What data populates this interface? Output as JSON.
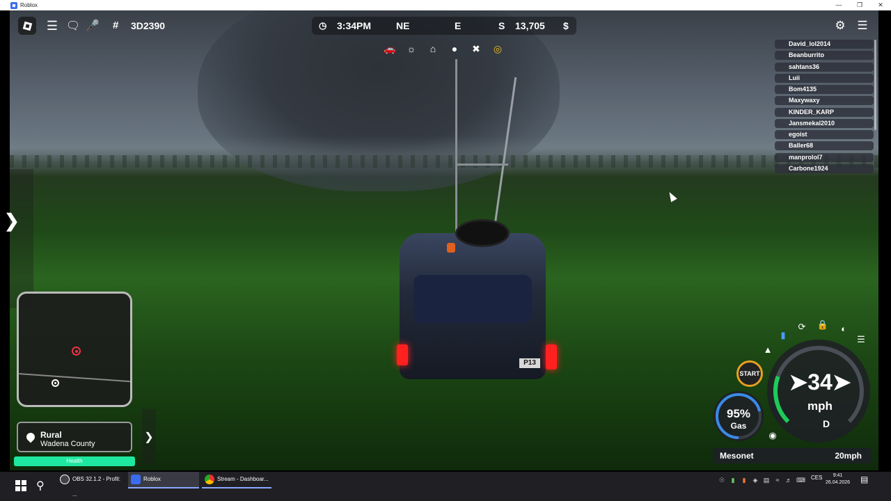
{
  "window": {
    "title": "Roblox",
    "buttons": [
      "—",
      "❐",
      "✕"
    ]
  },
  "hud": {
    "server_hash": "#",
    "server_id": "3D2390",
    "time": "3:34PM",
    "heading_primary": "NE",
    "heading_secondary": "E",
    "heading_tertiary": "S",
    "money": "13,705",
    "currency": "$",
    "toolbar_icons": [
      "car-icon",
      "sun-icon",
      "home-icon",
      "person-icon",
      "tools-icon",
      "radar-icon"
    ]
  },
  "players": [
    "David_lol2014",
    "Beanburrito",
    "sahtans36",
    "Luii",
    "Bom4135",
    "Maxywaxy",
    "KINDER_KARP",
    "Jansmekal2010",
    "egoist",
    "Baller68",
    "manprolol7",
    "Carbone1924"
  ],
  "location": {
    "area": "Rural",
    "county": "Wadena County"
  },
  "health": {
    "label": "Health",
    "value": 1.0,
    "color": "#1ee8a0"
  },
  "vehicle": {
    "speed": "34",
    "speed_unit": "mph",
    "gear": "D",
    "gas_percent": "95%",
    "gas_value": 0.95,
    "gas_label": "Gas",
    "start_label": "START",
    "plate": "P13",
    "accent": "#1ecb5a"
  },
  "mesonet": {
    "label": "Mesonet",
    "wind": "20mph"
  },
  "taskbar": {
    "tasks": [
      "OBS 32.1.2 - Profil: ...",
      "Roblox",
      "Stream - Dashboar..."
    ],
    "lang": "CES",
    "time": "9:41",
    "date": "26.04.2026"
  }
}
